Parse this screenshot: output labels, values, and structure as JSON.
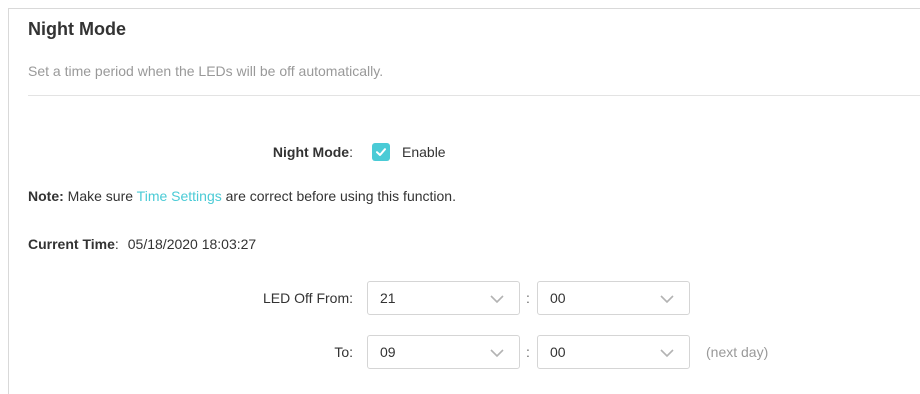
{
  "section": {
    "title": "Night Mode",
    "description": "Set a time period when the LEDs will be off automatically."
  },
  "night_mode": {
    "label": "Night Mode",
    "colon": ":",
    "checkbox_checked": true,
    "enable_label": "Enable"
  },
  "note": {
    "prefix": "Note:",
    "text_before": " Make sure ",
    "link": "Time Settings",
    "text_after": " are correct before using this function."
  },
  "current_time": {
    "label": "Current Time",
    "colon": ":",
    "value": "05/18/2020 18:03:27"
  },
  "led_off_from": {
    "label": "LED Off From:",
    "hour": "21",
    "minute": "00"
  },
  "to": {
    "label": "To:",
    "hour": "09",
    "minute": "00",
    "suffix": "(next day)"
  },
  "time_separator": ":",
  "icons": {
    "checkbox": "check-icon",
    "dropdown": "chevron-down-icon"
  },
  "colors": {
    "accent": "#4acbd6",
    "text": "#333333",
    "muted": "#999999"
  }
}
